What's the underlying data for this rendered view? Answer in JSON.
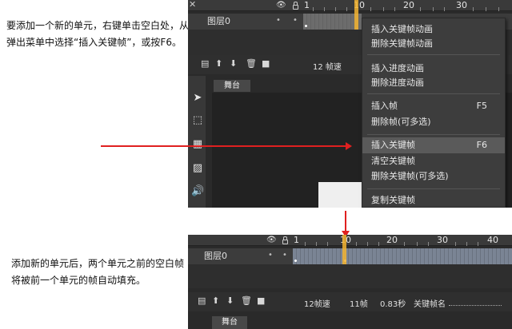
{
  "captions": {
    "top": "要添加一个新的单元，右键单击空白处，从弹出菜单中选择“插入关键帧”，或按F6。",
    "bottom": "添加新的单元后，两个单元之前的空白帧将被前一个单元的帧自动填充。"
  },
  "top_shot": {
    "ruler": [
      "1",
      "10",
      "20",
      "30"
    ],
    "layer_name": "图层0",
    "fps": "12 帧速",
    "stage_tab": "舞台",
    "context_menu": [
      {
        "label": "插入关键帧动画",
        "shortcut": ""
      },
      {
        "label": "删除关键帧动画",
        "shortcut": ""
      },
      {
        "label": "插入进度动画",
        "shortcut": ""
      },
      {
        "label": "删除进度动画",
        "shortcut": ""
      },
      {
        "label": "插入帧",
        "shortcut": "F5"
      },
      {
        "label": "删除帧(可多选)",
        "shortcut": ""
      },
      {
        "label": "插入关键帧",
        "shortcut": "F6"
      },
      {
        "label": "清空关键帧",
        "shortcut": ""
      },
      {
        "label": "删除关键帧(可多选)",
        "shortcut": ""
      },
      {
        "label": "复制关键帧",
        "shortcut": ""
      }
    ]
  },
  "bottom_shot": {
    "ruler": [
      "1",
      "10",
      "20",
      "30",
      "40"
    ],
    "layer_name": "图层0",
    "fps": "12帧速",
    "frame": "11帧",
    "time": "0.83秒",
    "keyframe_name": "关键帧名",
    "stage_tab": "舞台"
  },
  "colors": {
    "arrow": "#e02020",
    "playhead": "#f3b431",
    "highlight": "#5a5a5a"
  }
}
